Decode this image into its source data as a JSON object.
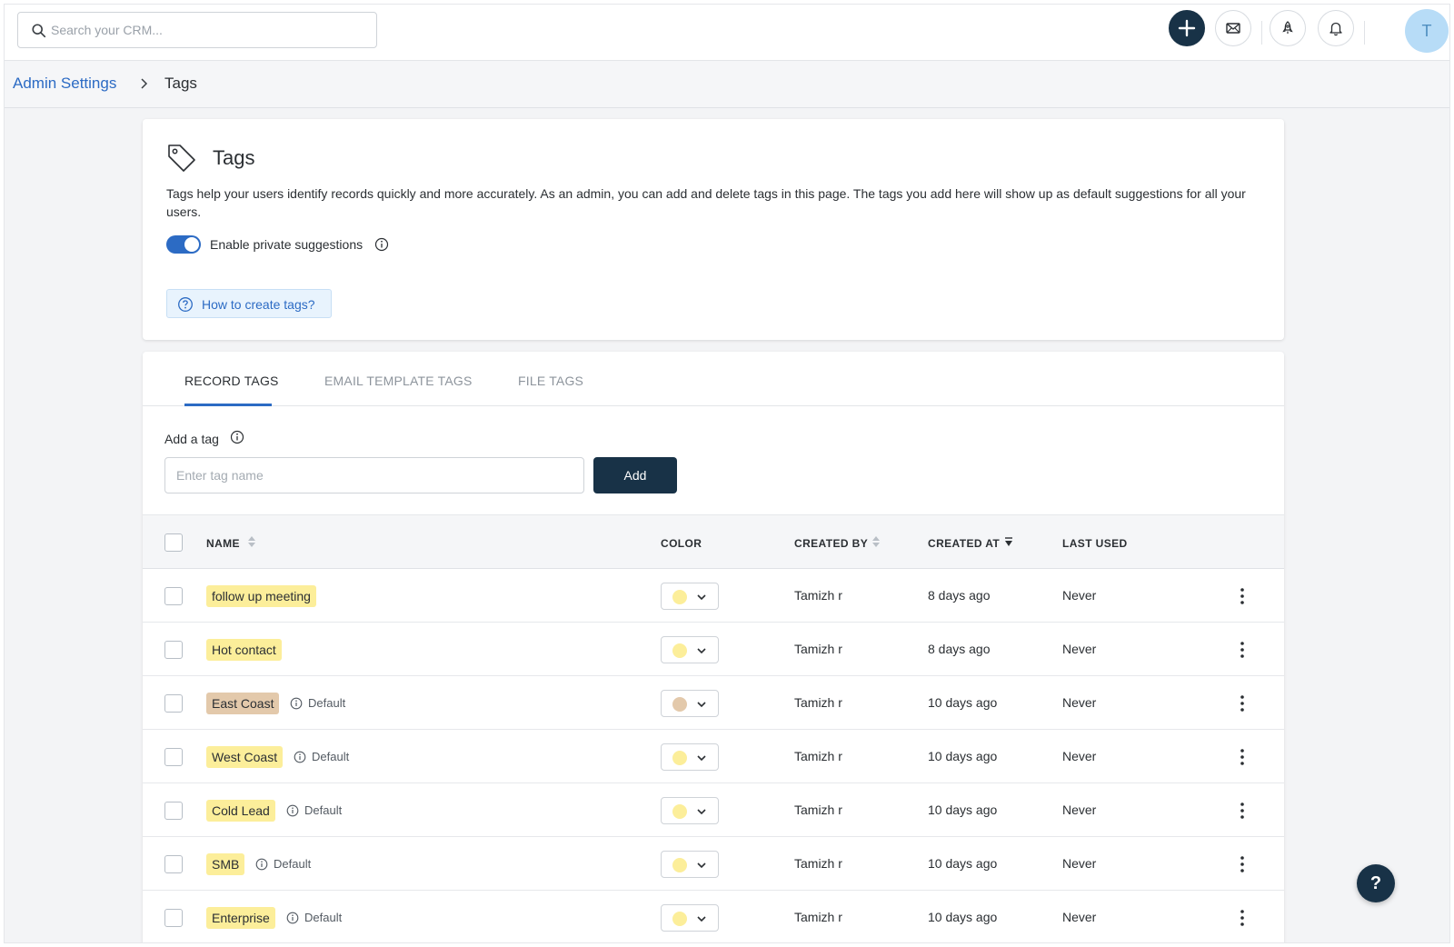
{
  "search": {
    "placeholder": "Search your CRM..."
  },
  "header_icons": [
    "plus-icon",
    "mail-icon",
    "rocket-icon",
    "bell-icon"
  ],
  "avatar": {
    "initial": "T"
  },
  "breadcrumb": {
    "parent": "Admin Settings",
    "current": "Tags"
  },
  "intro": {
    "title": "Tags",
    "description": "Tags help your users identify records quickly and more accurately. As an admin, you can add and delete tags in this page. The tags you add here will show up as default suggestions for all your users.",
    "toggle_label": "Enable private suggestions",
    "toggle_on": true,
    "help_link": "How to create tags?"
  },
  "tabs": [
    {
      "label": "RECORD TAGS",
      "active": true
    },
    {
      "label": "EMAIL TEMPLATE TAGS",
      "active": false
    },
    {
      "label": "FILE TAGS",
      "active": false
    }
  ],
  "add_tag": {
    "label": "Add a tag",
    "placeholder": "Enter tag name",
    "button": "Add"
  },
  "table": {
    "columns": {
      "name": "NAME",
      "color": "COLOR",
      "created_by": "CREATED BY",
      "created_at": "CREATED AT",
      "last_used": "LAST USED"
    },
    "rows": [
      {
        "name": "follow up meeting",
        "default": "",
        "color": "#fcee9a",
        "created_by": "Tamizh r",
        "created_at": "8 days ago",
        "last_used": "Never"
      },
      {
        "name": "Hot contact",
        "default": "",
        "color": "#fcee9a",
        "created_by": "Tamizh r",
        "created_at": "8 days ago",
        "last_used": "Never"
      },
      {
        "name": "East Coast",
        "default": "Default",
        "color": "#e3c9ab",
        "created_by": "Tamizh r",
        "created_at": "10 days ago",
        "last_used": "Never"
      },
      {
        "name": "West Coast",
        "default": "Default",
        "color": "#fcee9a",
        "created_by": "Tamizh r",
        "created_at": "10 days ago",
        "last_used": "Never"
      },
      {
        "name": "Cold Lead",
        "default": "Default",
        "color": "#fcee9a",
        "created_by": "Tamizh r",
        "created_at": "10 days ago",
        "last_used": "Never"
      },
      {
        "name": "SMB",
        "default": "Default",
        "color": "#fcee9a",
        "created_by": "Tamizh r",
        "created_at": "10 days ago",
        "last_used": "Never"
      },
      {
        "name": "Enterprise",
        "default": "Default",
        "color": "#fcee9a",
        "created_by": "Tamizh r",
        "created_at": "10 days ago",
        "last_used": "Never"
      }
    ]
  },
  "help_button": "?"
}
